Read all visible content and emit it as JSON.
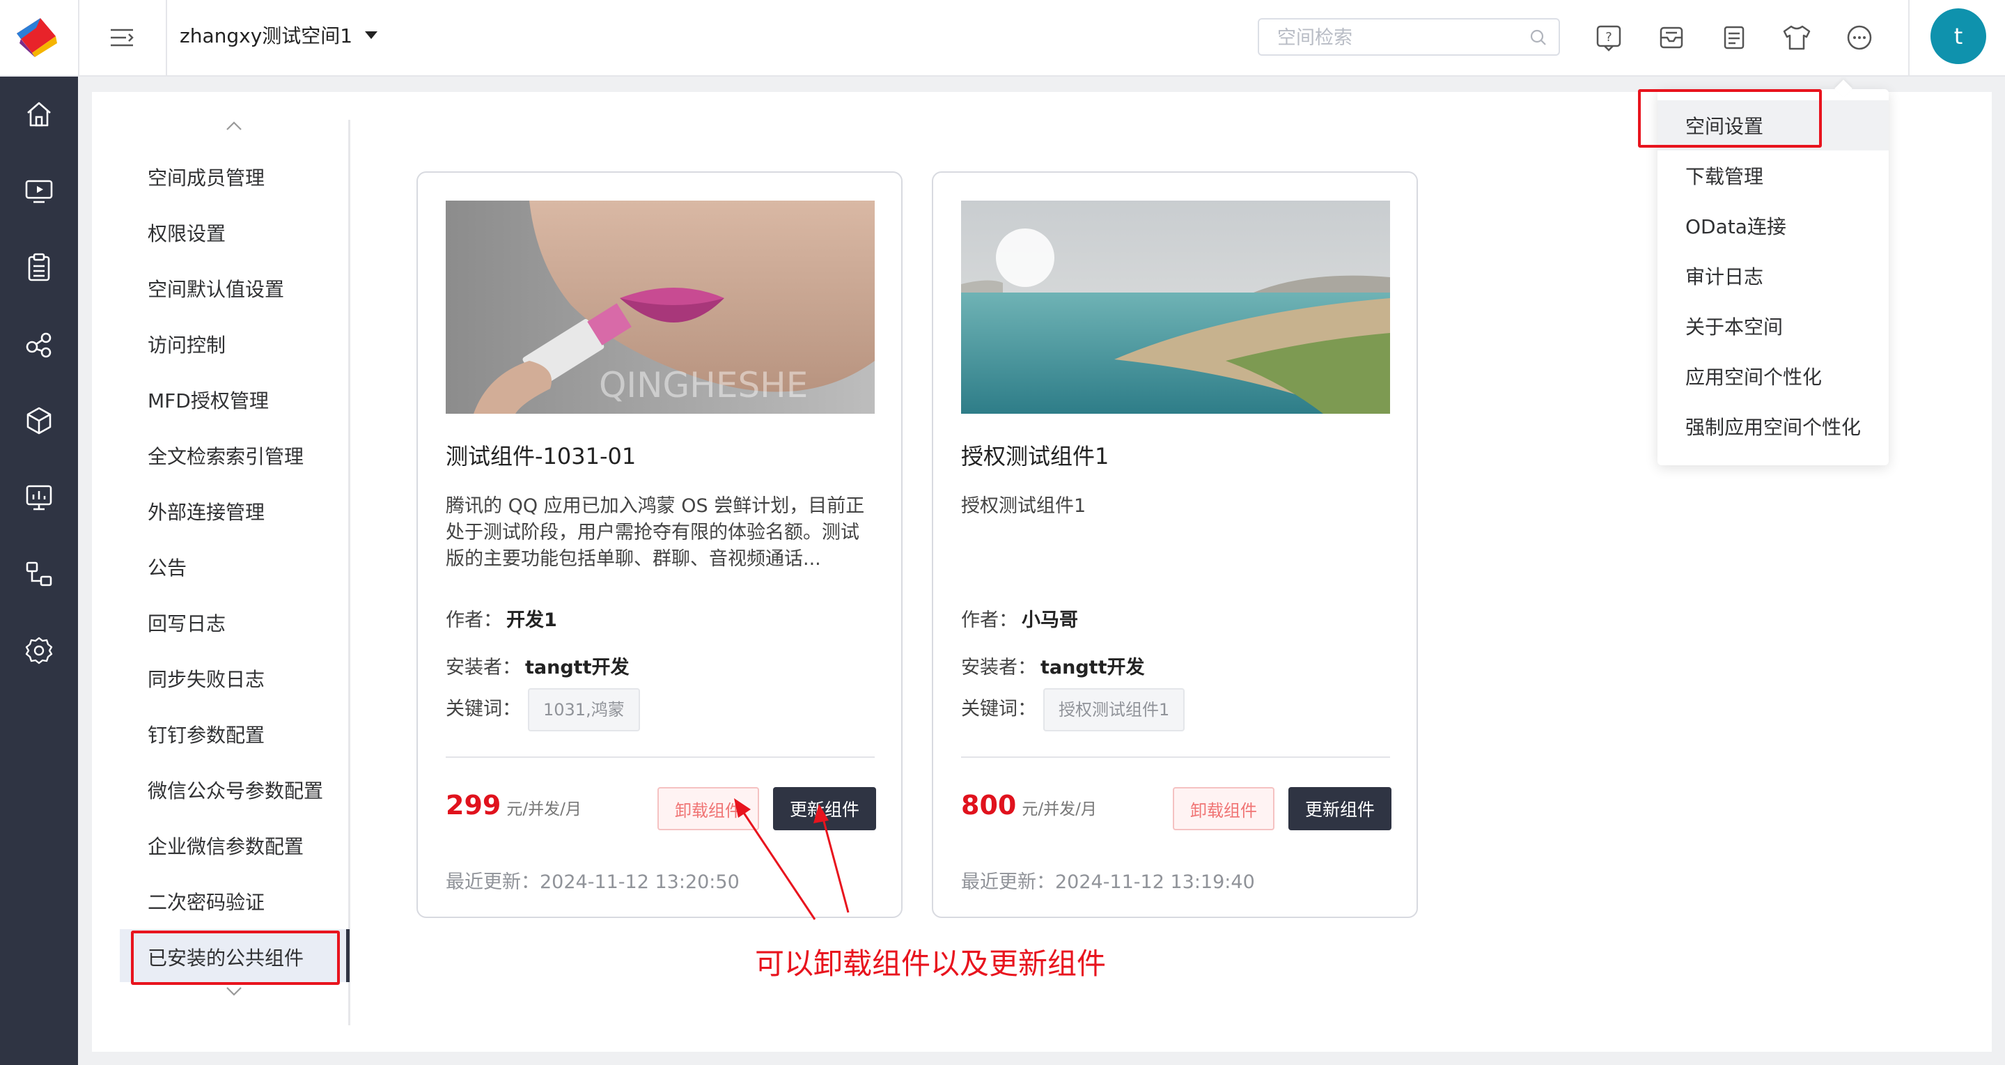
{
  "header": {
    "space_name": "zhangxy测试空间1",
    "search_placeholder": "空间检索",
    "icons": [
      "help-icon",
      "inbox-icon",
      "notes-icon",
      "theme-shirt-icon",
      "more-icon"
    ],
    "avatar_letter": "t"
  },
  "rail": {
    "icons": [
      "home-icon",
      "screen-icon",
      "clipboard-icon",
      "share-icon",
      "cube-icon",
      "monitor-icon",
      "flow-icon",
      "settings-icon"
    ]
  },
  "sidebar": {
    "items": [
      {
        "label": "空间成员管理"
      },
      {
        "label": "权限设置"
      },
      {
        "label": "空间默认值设置"
      },
      {
        "label": "访问控制"
      },
      {
        "label": "MFD授权管理"
      },
      {
        "label": "全文检索索引管理"
      },
      {
        "label": "外部连接管理"
      },
      {
        "label": "公告"
      },
      {
        "label": "回写日志"
      },
      {
        "label": "同步失败日志"
      },
      {
        "label": "钉钉参数配置"
      },
      {
        "label": "微信公众号参数配置"
      },
      {
        "label": "企业微信参数配置"
      },
      {
        "label": "二次密码验证"
      },
      {
        "label": "已安装的公共组件"
      }
    ],
    "active": "已安装的公共组件"
  },
  "cards": [
    {
      "title": "测试组件-1031-01",
      "description": "腾讯的 QQ 应用已加入鸿蒙 OS 尝鲜计划，目前正处于测试阶段，用户需抢夺有限的体验名额。测试版的主要功能包括单聊、群聊、音视频通话...",
      "author_label": "作者：",
      "author": "开发1",
      "installer_label": "安装者：",
      "installer": "tangtt开发",
      "keywords_label": "关键词：",
      "keywords": "1031,鸿蒙",
      "price": "299",
      "price_unit": "元/并发/月",
      "uninstall_label": "卸载组件",
      "update_label": "更新组件",
      "updated": "最近更新：2024-11-12 13:20:50",
      "image_watermark": "QINGHESHE"
    },
    {
      "title": "授权测试组件1",
      "description": "授权测试组件1",
      "author_label": "作者：",
      "author": "小马哥",
      "installer_label": "安装者：",
      "installer": "tangtt开发",
      "keywords_label": "关键词：",
      "keywords": "授权测试组件1",
      "price": "800",
      "price_unit": "元/并发/月",
      "uninstall_label": "卸载组件",
      "update_label": "更新组件",
      "updated": "最近更新：2024-11-12 13:19:40"
    }
  ],
  "dropdown": {
    "items": [
      {
        "label": "空间设置"
      },
      {
        "label": "下载管理"
      },
      {
        "label": "OData连接"
      },
      {
        "label": "审计日志"
      },
      {
        "label": "关于本空间"
      },
      {
        "label": "应用空间个性化"
      },
      {
        "label": "强制应用空间个性化"
      }
    ],
    "highlighted": "空间设置"
  },
  "annotation": {
    "text": "可以卸载组件以及更新组件",
    "color": "#e8141e"
  },
  "colors": {
    "rail_bg": "#2f3443",
    "primary_button": "#2f3443",
    "price": "#e0121d",
    "avatar": "#0f92ad"
  }
}
